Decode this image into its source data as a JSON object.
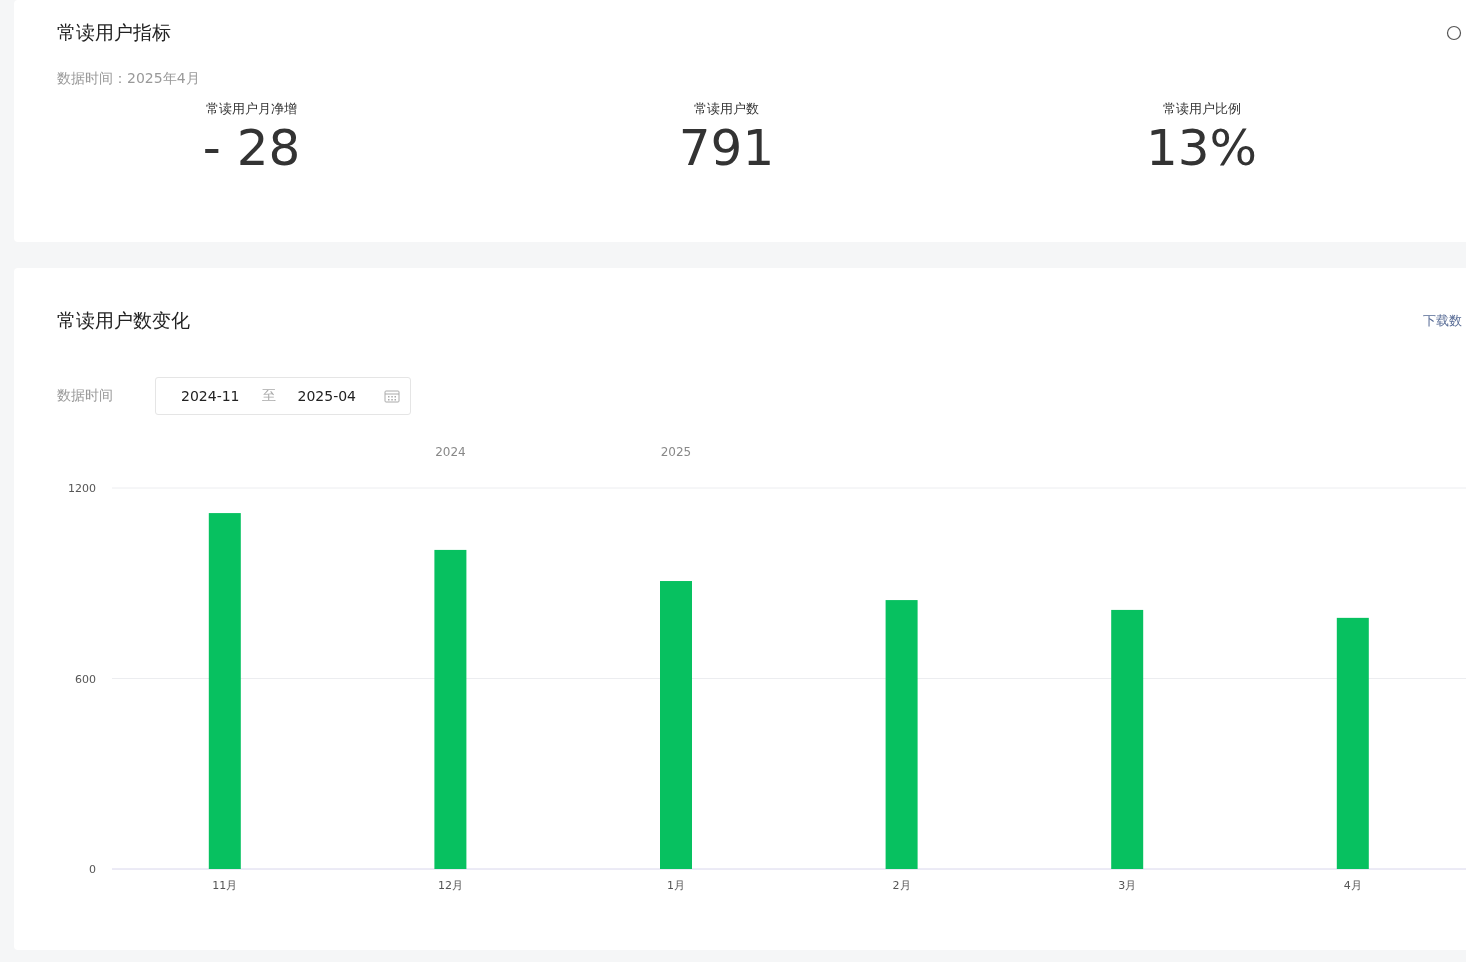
{
  "indicators_card": {
    "title": "常读用户指标",
    "data_time": "数据时间：2025年4月",
    "metrics": [
      {
        "label": "常读用户月净增",
        "value": "- 28"
      },
      {
        "label": "常读用户数",
        "value": "791"
      },
      {
        "label": "常读用户比例",
        "value": "13%"
      }
    ]
  },
  "trend_card": {
    "title": "常读用户数变化",
    "download_link": "下载数",
    "filter_label": "数据时间",
    "date_range": {
      "start": "2024-11",
      "separator": "至",
      "end": "2025-04"
    },
    "chart_data": {
      "type": "bar",
      "categories": [
        "11月",
        "12月",
        "1月",
        "2月",
        "3月",
        "4月"
      ],
      "series": [
        {
          "color": "#07c160",
          "values": [
            1121,
            1005,
            907,
            847,
            816,
            791
          ]
        }
      ],
      "ylim": [
        0,
        1200
      ],
      "yticks": [
        0,
        600,
        1200
      ],
      "annotations": [
        "2024",
        "2025"
      ]
    }
  }
}
